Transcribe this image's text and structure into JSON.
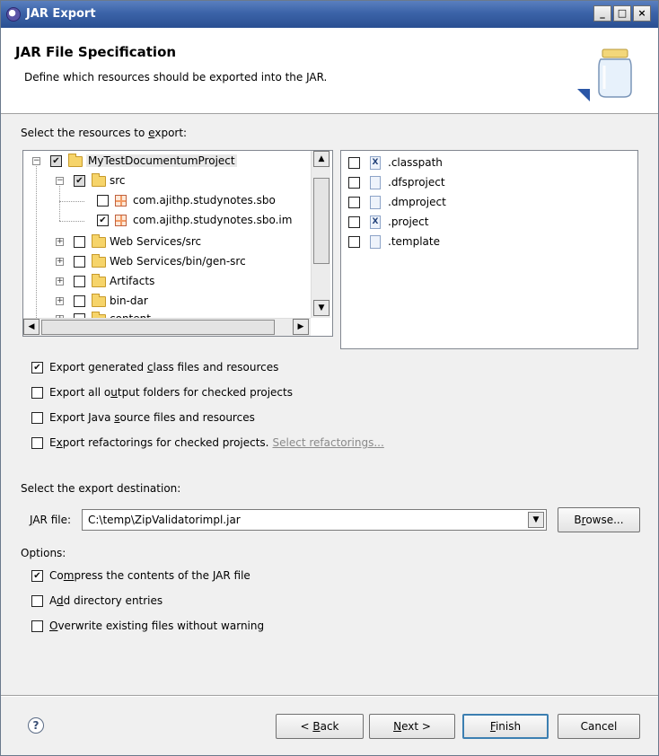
{
  "window": {
    "title": "JAR Export",
    "controls": {
      "minimize": "_",
      "maximize": "□",
      "close": "×"
    }
  },
  "header": {
    "title": "JAR File Specification",
    "description": "Define which resources should be exported into the JAR."
  },
  "resources_label": {
    "pre": "Select the resources to ",
    "mnemonic": "e",
    "post": "xport:"
  },
  "tree": {
    "items": [
      {
        "label": "MyTestDocumentumProject",
        "expander": "−",
        "checked": true,
        "icon": "project-folder-icon"
      },
      {
        "label": "src",
        "expander": "−",
        "checked": true,
        "icon": "source-folder-icon"
      },
      {
        "label": "com.ajithp.studynotes.sbo",
        "checked": false,
        "icon": "package-icon"
      },
      {
        "label": "com.ajithp.studynotes.sbo.im",
        "checked": true,
        "icon": "package-icon"
      },
      {
        "label": "Web Services/src",
        "expander": "+",
        "checked": false,
        "icon": "source-folder-icon"
      },
      {
        "label": "Web Services/bin/gen-src",
        "expander": "+",
        "checked": false,
        "icon": "source-folder-icon"
      },
      {
        "label": "Artifacts",
        "expander": "+",
        "checked": false,
        "icon": "folder-icon"
      },
      {
        "label": "bin-dar",
        "expander": "+",
        "checked": false,
        "icon": "folder-icon"
      },
      {
        "label": "content",
        "expander": "+",
        "checked": false,
        "icon": "folder-icon"
      }
    ]
  },
  "files": {
    "items": [
      {
        "label": ".classpath",
        "checked": false,
        "icon": "xml-file-icon"
      },
      {
        "label": ".dfsproject",
        "checked": false,
        "icon": "file-icon"
      },
      {
        "label": ".dmproject",
        "checked": false,
        "icon": "file-icon"
      },
      {
        "label": ".project",
        "checked": false,
        "icon": "xml-file-icon"
      },
      {
        "label": ".template",
        "checked": false,
        "icon": "file-icon"
      }
    ]
  },
  "export_options": [
    {
      "pre": "Export generated ",
      "mnemonic": "c",
      "post": "lass files and resources",
      "checked": true
    },
    {
      "pre": "Export all o",
      "mnemonic": "u",
      "post": "tput folders for checked projects",
      "checked": false
    },
    {
      "pre": "Export Java ",
      "mnemonic": "s",
      "post": "ource files and resources",
      "checked": false
    },
    {
      "pre": "E",
      "mnemonic": "x",
      "post": "port refactorings for checked projects.",
      "checked": false,
      "link": "Select refactorings..."
    }
  ],
  "destination": {
    "label": "Select the export destination:",
    "jar_label": {
      "pre": "",
      "mnemonic": "J",
      "post": "AR file:"
    },
    "jar_value": "C:\\temp\\ZipValidatorimpl.jar",
    "browse": {
      "pre": "B",
      "mnemonic": "r",
      "post": "owse..."
    }
  },
  "options": {
    "label": "Options:",
    "items": [
      {
        "pre": "Co",
        "mnemonic": "m",
        "post": "press the contents of the JAR file",
        "checked": true
      },
      {
        "pre": "A",
        "mnemonic": "d",
        "post": "d directory entries",
        "checked": false
      },
      {
        "pre": "",
        "mnemonic": "O",
        "post": "verwrite existing files without warning",
        "checked": false
      }
    ]
  },
  "footer": {
    "help": "?",
    "back": {
      "pre": "< ",
      "mnemonic": "B",
      "post": "ack"
    },
    "next": {
      "pre": "",
      "mnemonic": "N",
      "post": "ext >"
    },
    "finish": {
      "pre": "",
      "mnemonic": "F",
      "post": "inish"
    },
    "cancel": "Cancel"
  }
}
